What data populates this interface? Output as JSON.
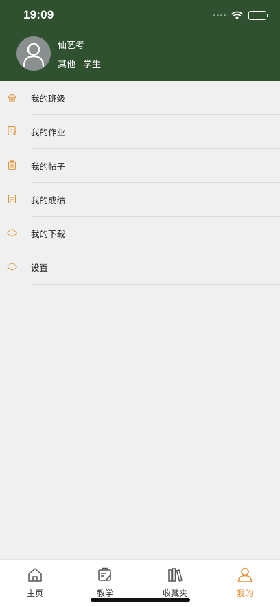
{
  "status_bar": {
    "time": "19:09"
  },
  "profile": {
    "name": "仙艺考",
    "school": "其他",
    "role": "学生"
  },
  "menu": {
    "items": [
      {
        "label": "我的班级",
        "icon": "class-icon"
      },
      {
        "label": "我的作业",
        "icon": "homework-icon"
      },
      {
        "label": "我的帖子",
        "icon": "posts-icon"
      },
      {
        "label": "我的成绩",
        "icon": "grades-icon"
      },
      {
        "label": "我的下载",
        "icon": "download-cloud-icon"
      },
      {
        "label": "设置",
        "icon": "settings-cloud-icon"
      }
    ]
  },
  "tabbar": {
    "tabs": [
      {
        "label": "主页",
        "icon": "home-icon",
        "active": false
      },
      {
        "label": "教学",
        "icon": "teaching-icon",
        "active": false
      },
      {
        "label": "收藏夹",
        "icon": "favorites-icon",
        "active": false
      },
      {
        "label": "我的",
        "icon": "person-icon",
        "active": true
      }
    ]
  },
  "colors": {
    "header_bg": "#2f5130",
    "accent": "#e0943a",
    "page_bg": "#f0f0f0"
  }
}
